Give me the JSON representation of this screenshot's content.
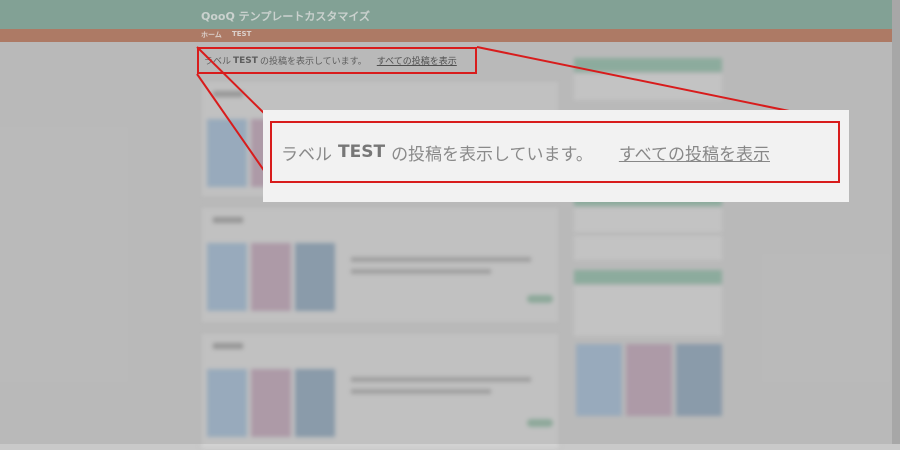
{
  "header": {
    "site_title": "QooQ テンプレートカスタマイズ"
  },
  "nav": {
    "home": "ホーム",
    "current": "TEST"
  },
  "label_message": {
    "prefix": "ラベル",
    "label_name": "TEST",
    "suffix": "の投稿を表示しています。",
    "show_all_link": "すべての投稿を表示"
  },
  "colors": {
    "header": "#7fa898",
    "navbar": "#b97559",
    "highlight": "#d81c1c"
  }
}
